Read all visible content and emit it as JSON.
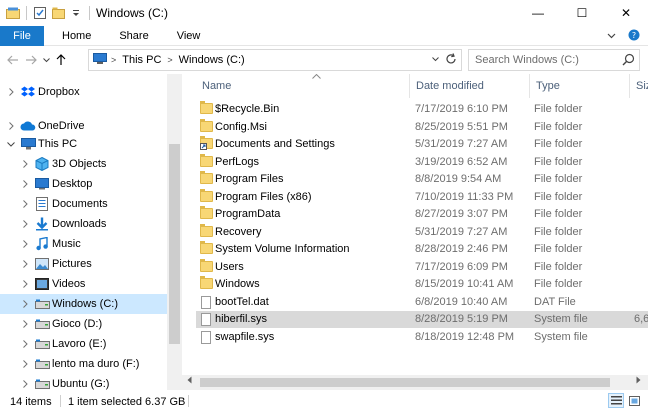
{
  "window": {
    "title": "Windows (C:)",
    "controls": {
      "minimize": "—",
      "maximize": "☐",
      "close": "✕"
    }
  },
  "ribbon": {
    "tabs": [
      "File",
      "Home",
      "Share",
      "View"
    ]
  },
  "address": {
    "breadcrumbs": [
      "This PC",
      "Windows (C:)"
    ],
    "search_placeholder": "Search Windows (C:)"
  },
  "navpane": {
    "items": [
      {
        "label": "Dropbox",
        "icon": "dropbox-icon",
        "level": 0,
        "expand": "collapsed"
      },
      {
        "label": "OneDrive",
        "icon": "onedrive-icon",
        "level": 0,
        "expand": "collapsed"
      },
      {
        "label": "This PC",
        "icon": "this-pc-icon",
        "level": 0,
        "expand": "expanded"
      },
      {
        "label": "3D Objects",
        "icon": "3d-objects-icon",
        "level": 1,
        "expand": "collapsed"
      },
      {
        "label": "Desktop",
        "icon": "desktop-icon",
        "level": 1,
        "expand": "collapsed"
      },
      {
        "label": "Documents",
        "icon": "documents-icon",
        "level": 1,
        "expand": "collapsed"
      },
      {
        "label": "Downloads",
        "icon": "downloads-icon",
        "level": 1,
        "expand": "collapsed"
      },
      {
        "label": "Music",
        "icon": "music-icon",
        "level": 1,
        "expand": "collapsed"
      },
      {
        "label": "Pictures",
        "icon": "pictures-icon",
        "level": 1,
        "expand": "collapsed"
      },
      {
        "label": "Videos",
        "icon": "videos-icon",
        "level": 1,
        "expand": "collapsed"
      },
      {
        "label": "Windows (C:)",
        "icon": "drive-icon",
        "level": 1,
        "expand": "collapsed",
        "selected": true
      },
      {
        "label": "Gioco (D:)",
        "icon": "drive-icon",
        "level": 1,
        "expand": "collapsed"
      },
      {
        "label": "Lavoro (E:)",
        "icon": "drive-icon",
        "level": 1,
        "expand": "collapsed"
      },
      {
        "label": "lento ma duro (F:)",
        "icon": "drive-icon",
        "level": 1,
        "expand": "collapsed"
      },
      {
        "label": "Ubuntu (G:)",
        "icon": "drive-icon",
        "level": 1,
        "expand": "collapsed"
      }
    ]
  },
  "columns": [
    "Name",
    "Date modified",
    "Type",
    "Size"
  ],
  "files": [
    {
      "name": "$Recycle.Bin",
      "date": "7/17/2019 6:10 PM",
      "type": "File folder",
      "size": "",
      "kind": "folder"
    },
    {
      "name": "Config.Msi",
      "date": "8/25/2019 5:51 PM",
      "type": "File folder",
      "size": "",
      "kind": "folder"
    },
    {
      "name": "Documents and Settings",
      "date": "5/31/2019 7:27 AM",
      "type": "File folder",
      "size": "",
      "kind": "shortcut-folder"
    },
    {
      "name": "PerfLogs",
      "date": "3/19/2019 6:52 AM",
      "type": "File folder",
      "size": "",
      "kind": "folder"
    },
    {
      "name": "Program Files",
      "date": "8/8/2019 9:54 AM",
      "type": "File folder",
      "size": "",
      "kind": "folder"
    },
    {
      "name": "Program Files (x86)",
      "date": "7/10/2019 11:33 PM",
      "type": "File folder",
      "size": "",
      "kind": "folder"
    },
    {
      "name": "ProgramData",
      "date": "8/27/2019 3:07 PM",
      "type": "File folder",
      "size": "",
      "kind": "folder"
    },
    {
      "name": "Recovery",
      "date": "5/31/2019 7:27 AM",
      "type": "File folder",
      "size": "",
      "kind": "folder"
    },
    {
      "name": "System Volume Information",
      "date": "8/28/2019 2:46 PM",
      "type": "File folder",
      "size": "",
      "kind": "folder"
    },
    {
      "name": "Users",
      "date": "7/17/2019 6:09 PM",
      "type": "File folder",
      "size": "",
      "kind": "folder"
    },
    {
      "name": "Windows",
      "date": "8/15/2019 10:41 AM",
      "type": "File folder",
      "size": "",
      "kind": "folder"
    },
    {
      "name": "bootTel.dat",
      "date": "6/8/2019 10:40 AM",
      "type": "DAT File",
      "size": "",
      "kind": "file"
    },
    {
      "name": "hiberfil.sys",
      "date": "8/28/2019 5:19 PM",
      "type": "System file",
      "size": "6,6",
      "kind": "file",
      "selected": true
    },
    {
      "name": "swapfile.sys",
      "date": "8/18/2019 12:48 PM",
      "type": "System file",
      "size": "",
      "kind": "file"
    }
  ],
  "status": {
    "item_count": "14 items",
    "selection": "1 item selected  6.37 GB"
  },
  "colors": {
    "accent": "#1979ca",
    "selection": "#cce8ff",
    "row_selected": "#d9d9d9",
    "folder": "#f8d775"
  }
}
